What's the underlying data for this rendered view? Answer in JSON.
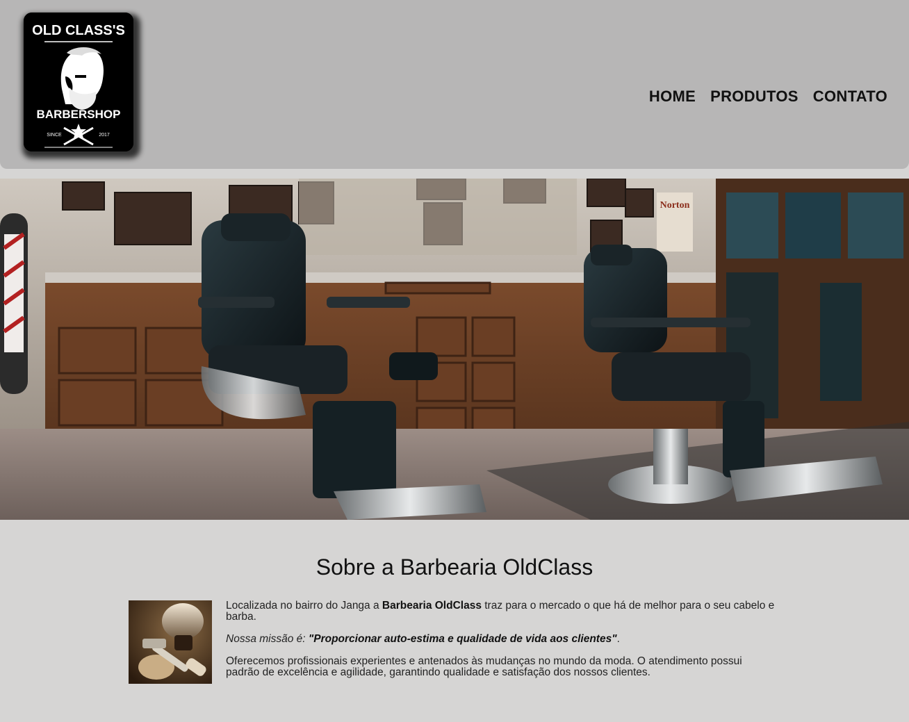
{
  "brand": {
    "logo_top_text": "OLD CLASS'S",
    "logo_bottom_text": "BARBERSHOP",
    "logo_since": "SINCE",
    "logo_year": "2017"
  },
  "nav": {
    "items": [
      {
        "label": "HOME"
      },
      {
        "label": "PRODUTOS"
      },
      {
        "label": "CONTATO"
      }
    ]
  },
  "hero": {
    "sign_text": "Norton"
  },
  "about": {
    "title": "Sobre a Barbearia OldClass",
    "p1_before": "Localizada no bairro do Janga a ",
    "p1_bold": "Barbearia OldClass",
    "p1_after": " traz para o mercado o que há de melhor para o seu cabelo e barba.",
    "p2_label": "Nossa missão é: ",
    "p2_quote": "\"Proporcionar auto-estima e qualidade de vida aos clientes\"",
    "p2_end": ".",
    "p3": "Oferecemos profissionais experientes e antenados às mudanças no mundo da moda. O atendimento possui padrão de excelência e agilidade, garantindo qualidade e satisfação dos nossos clientes."
  },
  "colors": {
    "header_bg": "#b7b6b6",
    "page_bg": "#d6d5d4",
    "text": "#111111"
  }
}
